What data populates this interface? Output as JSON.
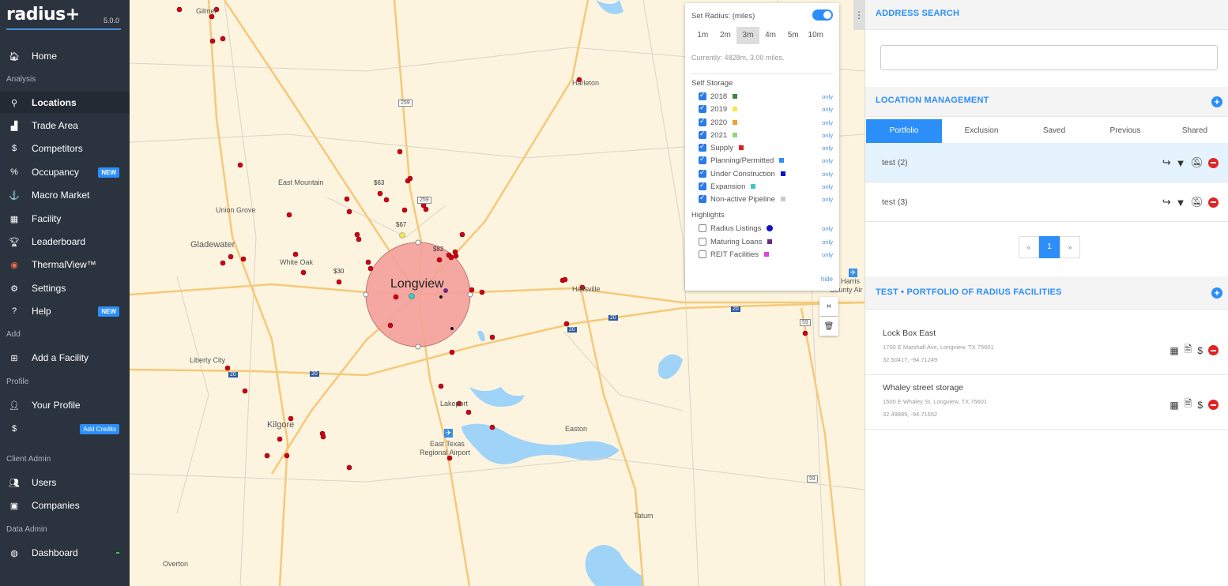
{
  "app": {
    "logo": "radius+",
    "version": "5.0.0"
  },
  "sidebar": {
    "items": [
      {
        "label": "Home",
        "icon": "home-icon",
        "glyph": "🏠︎"
      },
      {
        "label": "Locations",
        "icon": "search-icon",
        "glyph": "⚲"
      },
      {
        "label": "Trade Area",
        "icon": "area-chart-icon",
        "glyph": "▟"
      },
      {
        "label": "Competitors",
        "icon": "dollar-icon",
        "glyph": "$"
      },
      {
        "label": "Occupancy",
        "icon": "percent-icon",
        "glyph": "%"
      },
      {
        "label": "Macro Market",
        "icon": "anchor-icon",
        "glyph": "⚓"
      },
      {
        "label": "Facility",
        "icon": "building-icon",
        "glyph": "▦"
      },
      {
        "label": "Leaderboard",
        "icon": "trophy-icon",
        "glyph": "🏆︎"
      },
      {
        "label": "ThermalView™",
        "icon": "flame-icon",
        "glyph": "◉"
      },
      {
        "label": "Settings",
        "icon": "gear-icon",
        "glyph": "⚙"
      },
      {
        "label": "Help",
        "icon": "help-icon",
        "glyph": "?"
      },
      {
        "label": "Add a Facility",
        "icon": "plus-square-icon",
        "glyph": "⊞"
      },
      {
        "label": "Your Profile",
        "icon": "user-icon",
        "glyph": "👤︎"
      },
      {
        "label": "",
        "icon": "coin-icon",
        "glyph": "$"
      },
      {
        "label": "Users",
        "icon": "users-icon",
        "glyph": "👥︎"
      },
      {
        "label": "Companies",
        "icon": "address-card-icon",
        "glyph": "▣"
      },
      {
        "label": "Dashboard",
        "icon": "globe-icon",
        "glyph": "◍"
      }
    ],
    "sections": {
      "analysis": "Analysis",
      "add": "Add",
      "profile": "Profile",
      "client_admin": "Client Admin",
      "data_admin": "Data Admin"
    },
    "badges": {
      "occupancy": "NEW",
      "help": "NEW",
      "add_credits": "Add Credits"
    }
  },
  "map": {
    "places": [
      {
        "label": "Gilmer"
      },
      {
        "label": "Harleton"
      },
      {
        "label": "East Mountain"
      },
      {
        "label": "Union Grove"
      },
      {
        "label": "Gladewater"
      },
      {
        "label": "White Oak"
      },
      {
        "label": "Longview"
      },
      {
        "label": "Hallsville"
      },
      {
        "label": "Liberty City"
      },
      {
        "label": "Kilgore"
      },
      {
        "label": "Lakeport"
      },
      {
        "label": "East Texas"
      },
      {
        "label": "Regional Airport"
      },
      {
        "label": "Easton"
      },
      {
        "label": "Tatum"
      },
      {
        "label": "Overton"
      },
      {
        "label": "Harris"
      },
      {
        "label": "County Air"
      }
    ],
    "prices": [
      "$63",
      "$67",
      "$82",
      "$30"
    ],
    "shields": [
      "259",
      "259",
      "20",
      "20",
      "20",
      "20",
      "20",
      "59",
      "59"
    ]
  },
  "radius_panel": {
    "title": "Set Radius: (miles)",
    "options": [
      "1m",
      "2m",
      "3m",
      "4m",
      "5m",
      "10m"
    ],
    "selected": "3m",
    "current": "Currently: 4828m, 3.00 miles.",
    "self_storage_heading": "Self Storage",
    "self_storage": [
      {
        "label": "2018",
        "color": "#3a8a3a"
      },
      {
        "label": "2019",
        "color": "#f2e84a"
      },
      {
        "label": "2020",
        "color": "#f0a030"
      },
      {
        "label": "2021",
        "color": "#8fd67a"
      },
      {
        "label": "Supply",
        "color": "#e02020"
      },
      {
        "label": "Planning/Permitted",
        "color": "#2c8ef8"
      },
      {
        "label": "Under Construction",
        "color": "#1010d0"
      },
      {
        "label": "Expansion",
        "color": "#3cc8c8"
      },
      {
        "label": "Non-active Pipeline",
        "color": "#c8c8c8"
      }
    ],
    "highlights_heading": "Highlights",
    "highlights": [
      {
        "label": "Radius Listings",
        "color": "#1010d0"
      },
      {
        "label": "Maturing Loans",
        "color": "#6a2a8a"
      },
      {
        "label": "REIT Facilities",
        "color": "#e040e0"
      }
    ],
    "only_label": "only",
    "hide_label": "hide"
  },
  "right_panel": {
    "address_search": "ADDRESS SEARCH",
    "location_management": "LOCATION MANAGEMENT",
    "tabs": [
      "Portfolio",
      "Exclusion",
      "Saved",
      "Previous",
      "Shared"
    ],
    "portfolios": [
      {
        "name": "test (2)"
      },
      {
        "name": "test (3)"
      }
    ],
    "pager": {
      "prev": "«",
      "page": "1",
      "next": "»"
    },
    "facilities_title": "TEST • PORTFOLIO OF RADIUS FACILITIES",
    "facilities": [
      {
        "name": "Lock Box East",
        "address": "1700 E Marshall Ave, Longview, TX 75601",
        "coords": "32.50417, -94.71249"
      },
      {
        "name": "Whaley street storage",
        "address": "1500 E Whaley St, Longview, TX 75601",
        "coords": "32.49889, -94.71652"
      }
    ]
  },
  "colors": {
    "accent": "#2c8ef8",
    "sidebar": "#2b333e",
    "radius_fill": "#f4a09a",
    "marker": "#e02020"
  }
}
